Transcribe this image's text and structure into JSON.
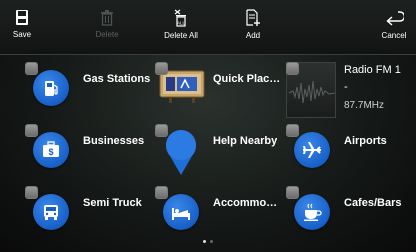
{
  "toolbar": {
    "save_label": "Save",
    "delete_label": "Delete",
    "delete_all_label": "Delete All",
    "add_label": "Add",
    "cancel_label": "Cancel"
  },
  "tiles": [
    {
      "label": "Gas Stations",
      "icon": "gas-station-icon"
    },
    {
      "label": "Quick Plac…",
      "icon": "quick-place-icon"
    },
    {
      "label": "Radio FM 1",
      "icon": "radio-waveform-icon",
      "extra": "-",
      "freq": "87.7MHz"
    },
    {
      "label": "Businesses",
      "icon": "briefcase-icon"
    },
    {
      "label": "Help Nearby",
      "icon": "location-pin-icon"
    },
    {
      "label": "Airports",
      "icon": "airplane-icon"
    },
    {
      "label": "Semi Truck",
      "icon": "truck-icon"
    },
    {
      "label": "Accommo…",
      "icon": "bed-icon"
    },
    {
      "label": "Cafes/Bars",
      "icon": "coffee-cup-icon"
    }
  ],
  "colors": {
    "accent_blue": "#1f6fd8",
    "background": "#151917"
  },
  "pagination": {
    "pages": 2,
    "current": 1
  }
}
